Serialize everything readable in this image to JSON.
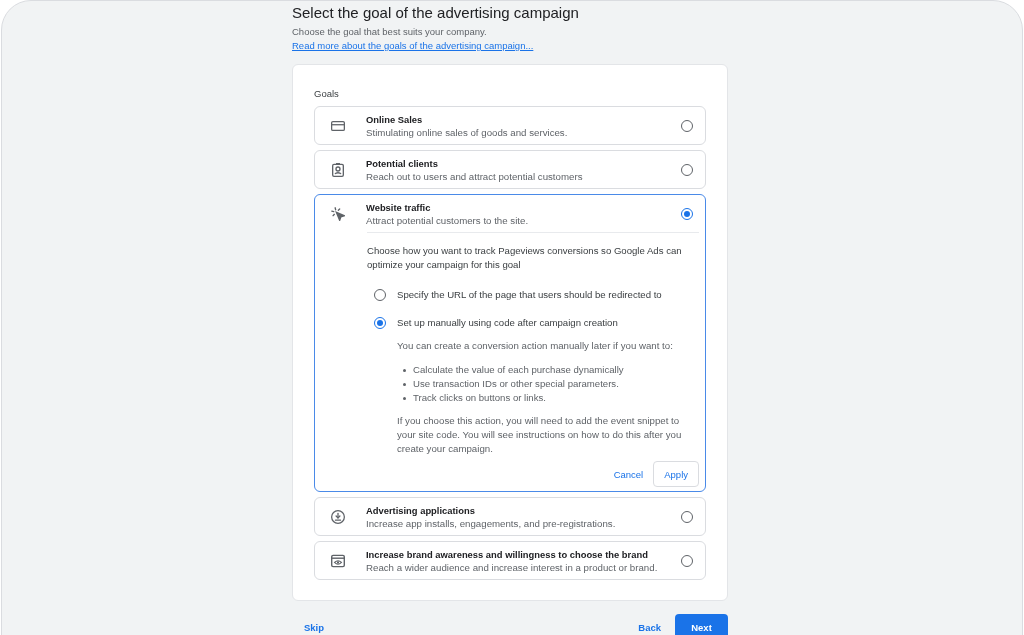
{
  "header": {
    "title": "Select the goal of the advertising campaign",
    "subtitle": "Choose the goal that best suits your company.",
    "link": "Read more about the goals of the advertising campaign..."
  },
  "goals": {
    "label": "Goals",
    "options": [
      {
        "title": "Online Sales",
        "description": "Stimulating online sales of goods and services.",
        "selected": false,
        "expanded": false
      },
      {
        "title": "Potential clients",
        "description": "Reach out to users and attract potential customers",
        "selected": false,
        "expanded": false
      },
      {
        "title": "Website traffic",
        "description": "Attract potential customers to the site.",
        "selected": true,
        "expanded": true,
        "details": {
          "prompt": "Choose how you want to track Pageviews conversions so Google Ads can optimize your campaign for this goal",
          "methods": [
            {
              "label": "Specify the URL of the page that users should be redirected to",
              "selected": false
            },
            {
              "label": "Set up manually using code after campaign creation",
              "selected": true,
              "intro": "You can create a conversion action manually later if you want to:",
              "bullets": [
                "Calculate the value of each purchase dynamically",
                "Use transaction IDs or other special parameters.",
                "Track clicks on buttons or links."
              ],
              "note": "If you choose this action, you will need to add the event snippet to your site code. You will see instructions on how to do this after you create your campaign."
            }
          ],
          "actions": {
            "cancel": "Cancel",
            "apply": "Apply"
          }
        }
      },
      {
        "title": "Advertising applications",
        "description": "Increase app installs, engagements, and pre-registrations.",
        "selected": false,
        "expanded": false
      },
      {
        "title": "Increase brand awareness and willingness to choose the brand",
        "description": "Reach a wider audience and increase interest in a product or brand.",
        "selected": false,
        "expanded": false
      }
    ]
  },
  "footer": {
    "skip": "Skip",
    "back": "Back",
    "next": "Next"
  }
}
